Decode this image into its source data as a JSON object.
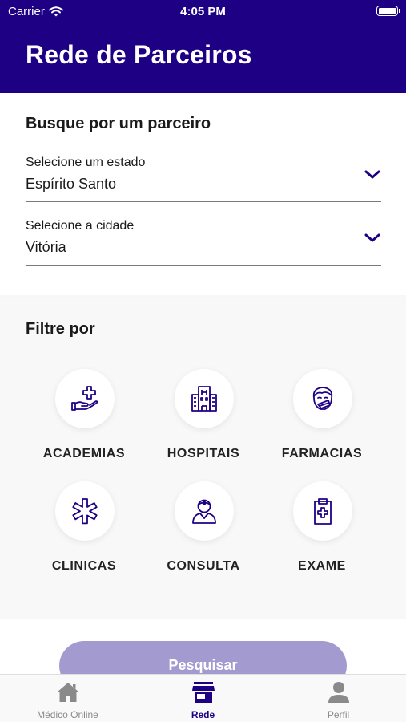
{
  "status": {
    "carrier": "Carrier",
    "time": "4:05 PM"
  },
  "header": {
    "title": "Rede de Parceiros"
  },
  "search": {
    "title": "Busque por um parceiro",
    "state_label": "Selecione um estado",
    "state_value": "Espírito Santo",
    "city_label": "Selecione a cidade",
    "city_value": "Vitória"
  },
  "filters": {
    "title": "Filtre por",
    "items": [
      {
        "label": "ACADEMIAS",
        "icon": "hand-plus-icon"
      },
      {
        "label": "HOSPITAIS",
        "icon": "hospital-building-icon"
      },
      {
        "label": "FARMACIAS",
        "icon": "sick-face-icon"
      },
      {
        "label": "CLINICAS",
        "icon": "medical-star-icon"
      },
      {
        "label": "CONSULTA",
        "icon": "doctor-icon"
      },
      {
        "label": "EXAME",
        "icon": "clipboard-plus-icon"
      }
    ]
  },
  "actions": {
    "search_label": "Pesquisar"
  },
  "tabbar": {
    "items": [
      {
        "label": "Médico Online",
        "icon": "home-icon",
        "active": false
      },
      {
        "label": "Rede",
        "icon": "store-icon",
        "active": true
      },
      {
        "label": "Perfil",
        "icon": "person-icon",
        "active": false
      }
    ]
  },
  "colors": {
    "primary": "#1e0085",
    "button": "#a39bd0",
    "inactive": "#8a8a8a"
  }
}
